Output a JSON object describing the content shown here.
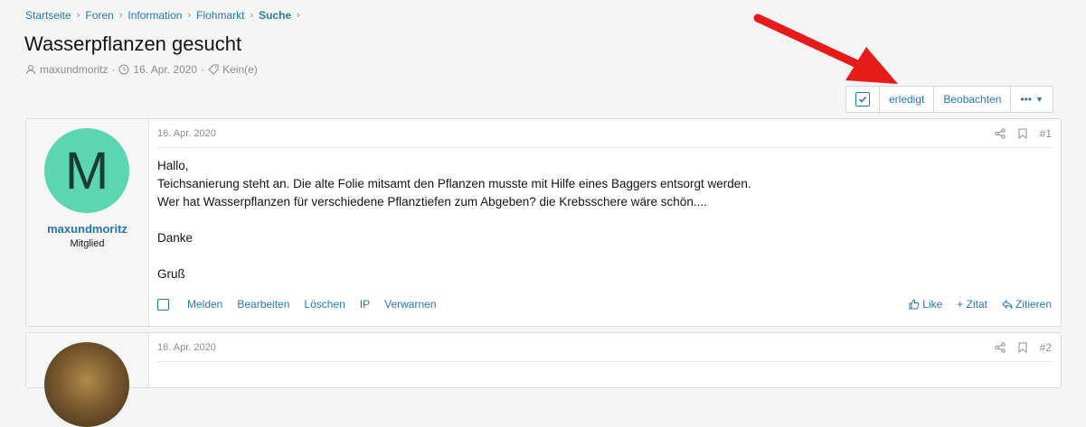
{
  "breadcrumb": [
    "Startseite",
    "Foren",
    "Information",
    "Flohmarkt",
    "Suche"
  ],
  "thread": {
    "title": "Wasserpflanzen gesucht",
    "author": "maxundmoritz",
    "date": "16. Apr. 2020",
    "tags": "Kein(e)"
  },
  "actions": {
    "erledigt": "erledigt",
    "beobachten": "Beobachten",
    "more": "•••"
  },
  "posts": [
    {
      "date": "16. Apr. 2020",
      "number": "#1",
      "user": {
        "avatar_letter": "M",
        "name": "maxundmoritz",
        "title": "Mitglied"
      },
      "body": [
        "Hallo,",
        "Teichsanierung steht an. Die alte Folie mitsamt den Pflanzen musste mit Hilfe eines Baggers entsorgt werden.",
        "Wer hat Wasserpflanzen für verschiedene Pflanztiefen zum Abgeben? die Krebsschere wäre schön....",
        "",
        "Danke",
        "",
        "Gruß"
      ],
      "footer": {
        "melden": "Melden",
        "bearbeiten": "Bearbeiten",
        "loeschen": "Löschen",
        "ip": "IP",
        "verwarnen": "Verwarnen",
        "like": "Like",
        "zitat": "+ Zitat",
        "zitieren": "Zitieren"
      }
    },
    {
      "date": "16. Apr. 2020",
      "number": "#2"
    }
  ],
  "colors": {
    "link": "#2577b1",
    "avatar": "#5cd6b0",
    "arrow": "#e81b1b"
  }
}
